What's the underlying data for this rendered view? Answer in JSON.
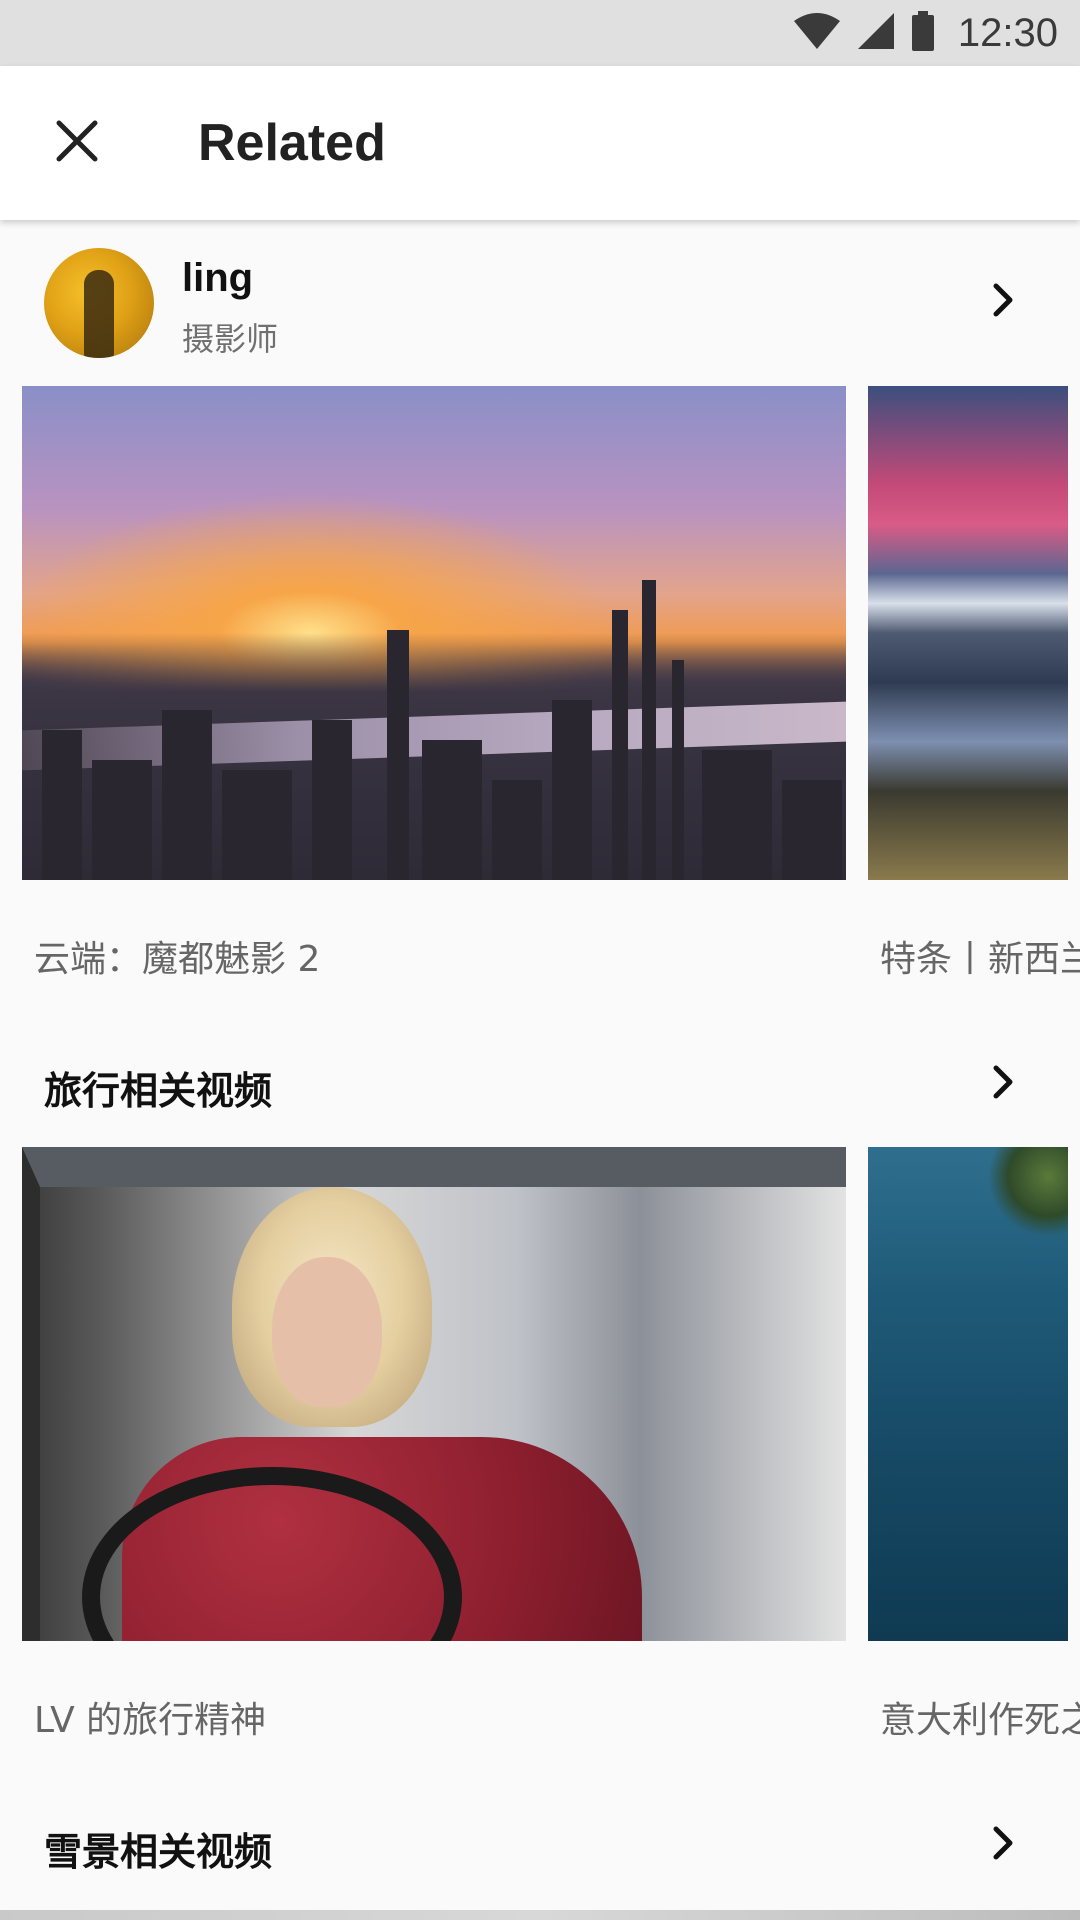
{
  "status_bar": {
    "time": "12:30",
    "icons": [
      "wifi-icon",
      "cellular-signal-icon",
      "battery-icon"
    ]
  },
  "app_bar": {
    "title": "Related",
    "close_icon": "close-icon"
  },
  "profile": {
    "name": "ling",
    "role": "摄影师",
    "chevron_icon": "chevron-right-icon"
  },
  "sections": [
    {
      "title": "",
      "cards": [
        {
          "caption": "云端：魔都魅影 2",
          "thumbnail": "city-sunset-thumbnail"
        },
        {
          "caption": "特条丨新西兰",
          "thumbnail": "mountain-lake-thumbnail"
        }
      ]
    },
    {
      "title": "旅行相关视频",
      "cards": [
        {
          "caption": "LV 的旅行精神",
          "thumbnail": "woman-in-car-thumbnail"
        },
        {
          "caption": "意大利作死之旅",
          "thumbnail": "ocean-aerial-thumbnail"
        }
      ]
    },
    {
      "title": "雪景相关视频",
      "cards": []
    }
  ],
  "colors": {
    "background": "#fafafa",
    "status_bar": "#e0e0e0",
    "app_bar": "#ffffff",
    "primary_text": "#111111",
    "secondary_text": "#666666"
  }
}
